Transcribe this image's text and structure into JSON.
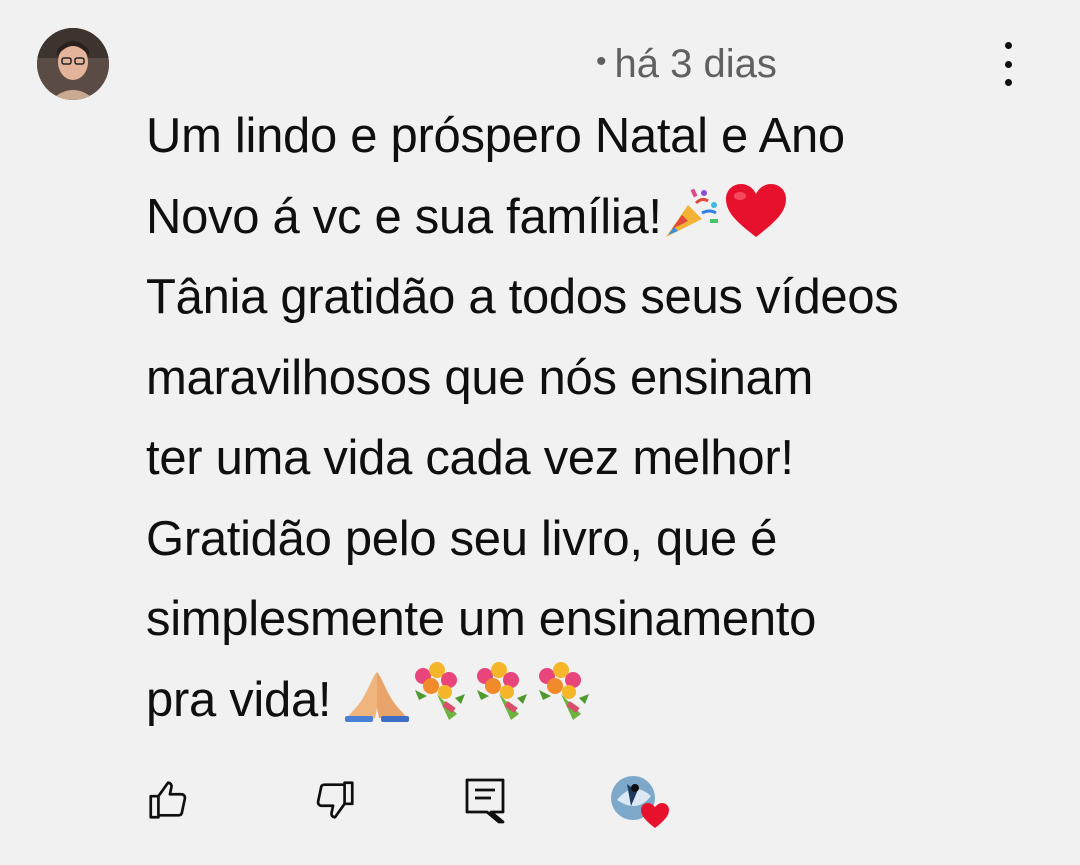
{
  "comment": {
    "timestamp_dot": "•",
    "timestamp": "há 3 dias",
    "lines": [
      "Um lindo e próspero Natal e Ano",
      "Novo á vc e sua família!",
      "Tânia gratidão a todos seus vídeos",
      "maravilhosos que nós ensinam",
      "ter uma vida cada vez melhor!",
      "Gratidão pelo seu livro, que é",
      "simplesmente um ensinamento",
      "pra vida!"
    ],
    "line2_emojis": [
      "party-popper-icon",
      "red-heart-icon"
    ],
    "line8_emojis": [
      "folded-hands-icon",
      "bouquet-icon",
      "bouquet-icon",
      "bouquet-icon"
    ]
  },
  "actions": {
    "like": "thumbs-up-icon",
    "dislike": "thumbs-down-icon",
    "reply": "reply-icon",
    "creator_heart": "creator-heart-icon"
  },
  "colors": {
    "background": "#f1f1f1",
    "text": "#0f0f0f",
    "meta": "#606060",
    "heart": "#e8112d"
  }
}
